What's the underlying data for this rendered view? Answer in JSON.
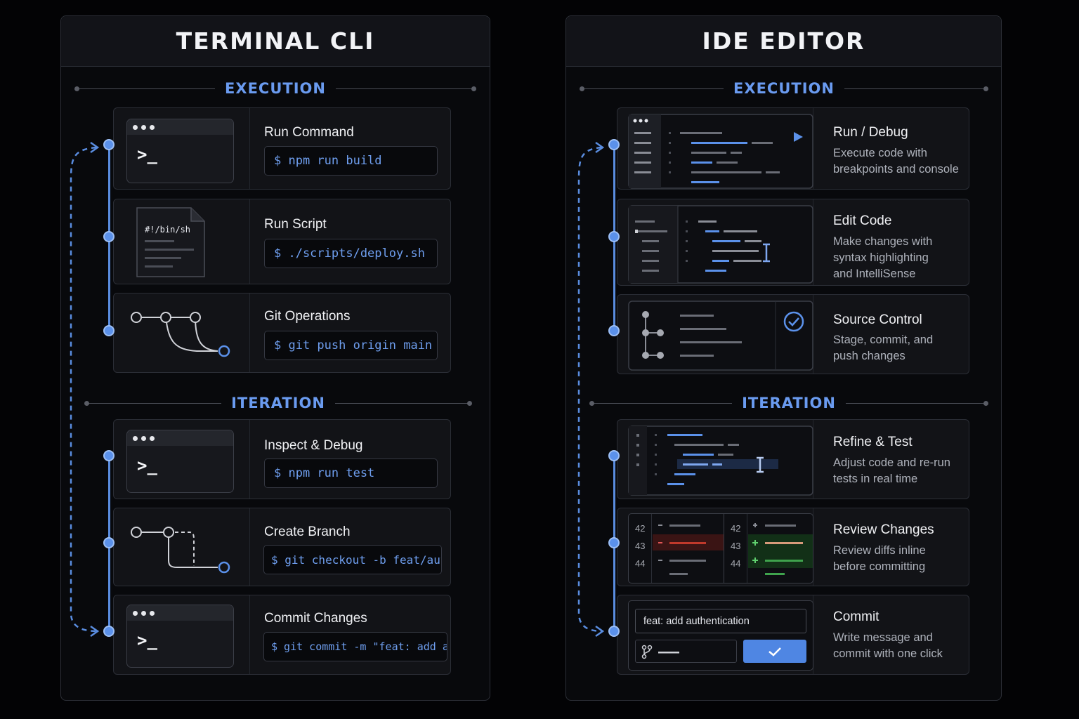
{
  "cli": {
    "title": "TERMINAL CLI",
    "execution_label": "EXECUTION",
    "iteration_label": "ITERATION",
    "cards": [
      {
        "title": "Run Command",
        "command": "$ npm run build",
        "icon": "terminal-prompt-icon"
      },
      {
        "title": "Run Script",
        "command": "$ ./scripts/deploy.sh",
        "file_label": "#!/bin/sh",
        "icon": "script-file-icon"
      },
      {
        "title": "Git Operations",
        "command": "$ git push origin main",
        "icon": "git-branch-icon"
      },
      {
        "title": "Inspect & Debug",
        "command": "$ npm run test",
        "icon": "terminal-prompt-icon"
      },
      {
        "title": "Create Branch",
        "command": "$ git checkout -b feat/auth",
        "icon": "git-branch-create-icon"
      },
      {
        "title": "Commit Changes",
        "command": "$ git commit -m \"feat: add auth\"",
        "icon": "terminal-prompt-icon"
      }
    ],
    "prompt_glyph": ">_"
  },
  "ide": {
    "title": "IDE EDITOR",
    "execution_label": "EXECUTION",
    "iteration_label": "ITERATION",
    "cards": [
      {
        "title": "Run / Debug",
        "description": "Execute code with\nbreakpoints and console",
        "icon": "run-debug-editor-icon"
      },
      {
        "title": "Edit Code",
        "description": "Make changes with\nsyntax highlighting\nand IntelliSense",
        "icon": "code-editor-icon"
      },
      {
        "title": "Source Control",
        "description": "Stage, commit, and\npush changes",
        "icon": "source-control-icon"
      },
      {
        "title": "Refine & Test",
        "description": "Adjust code and re-run\ntests in real time",
        "icon": "refine-editor-icon"
      },
      {
        "title": "Review Changes",
        "description": "Review diffs inline\nbefore committing",
        "icon": "diff-view-icon"
      },
      {
        "title": "Commit",
        "description": "Write message and\ncommit with one click",
        "icon": "commit-form-icon"
      }
    ],
    "diff_lines": {
      "left": [
        "42",
        "43",
        "44"
      ],
      "right": [
        "42",
        "43",
        "44"
      ]
    },
    "commit_message": "feat: add authentication"
  },
  "colors": {
    "accent": "#5b91ea",
    "added": "#3fa34d",
    "removed": "#c0392b",
    "background": "#030305"
  }
}
